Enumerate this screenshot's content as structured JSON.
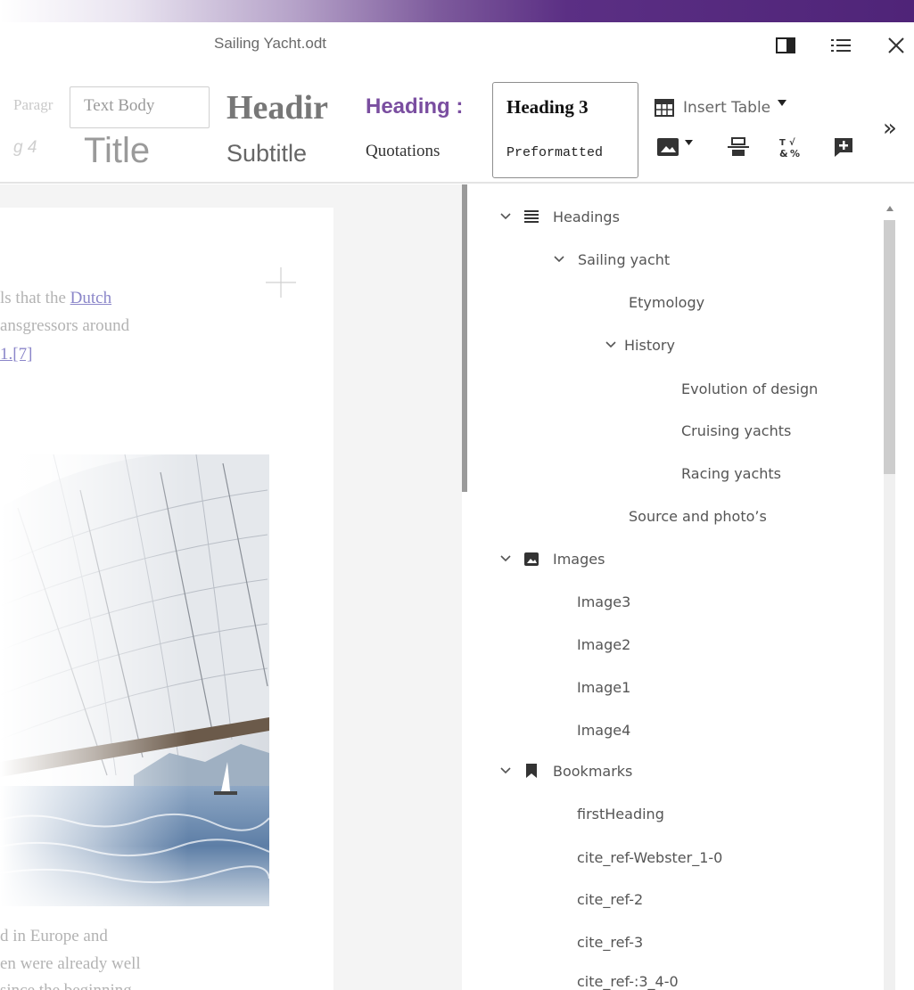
{
  "window": {
    "title": "Sailing Yacht.odt",
    "sidebar_icon": "sidebar-panel-icon",
    "menu_icon": "hamburger-list-icon",
    "close_icon": "close-icon"
  },
  "styles_gallery": {
    "row1": [
      {
        "label": "Paragr",
        "name": "style-paragraph"
      },
      {
        "label": "Text Body",
        "name": "style-text-body"
      },
      {
        "label": "Headir",
        "name": "style-heading-1"
      },
      {
        "label": "Heading :",
        "name": "style-heading-2"
      },
      {
        "label": "Heading 3",
        "name": "style-heading-3"
      }
    ],
    "row2": [
      {
        "label": "g 4",
        "name": "style-heading-4"
      },
      {
        "label": "Title",
        "name": "style-title"
      },
      {
        "label": "Subtitle",
        "name": "style-subtitle"
      },
      {
        "label": "Quotations",
        "name": "style-quotations"
      },
      {
        "label": "Preformatted",
        "name": "style-preformatted"
      }
    ]
  },
  "insert_toolbar": {
    "insert_table_label": "Insert Table",
    "more_label": "»",
    "icons": [
      "table-icon",
      "image-icon",
      "line-break-icon",
      "special-character-icon",
      "add-comment-icon"
    ]
  },
  "document": {
    "lines_top": [
      "ls that the ",
      "Dutch ",
      "ansgressors around",
      "1.[7]"
    ],
    "link_text": "Dutch",
    "lines_bottom": [
      "d in Europe and",
      "en were already well",
      "since the beginning"
    ]
  },
  "navigator": {
    "categories": [
      {
        "label": "Headings",
        "icon": "headings-icon",
        "expanded": true,
        "items": [
          {
            "label": "Sailing yacht",
            "level": 1,
            "expanded": true
          },
          {
            "label": "Etymology",
            "level": 2
          },
          {
            "label": "History",
            "level": 2,
            "expanded": true
          },
          {
            "label": "Evolution of design",
            "level": 3
          },
          {
            "label": "Cruising yachts",
            "level": 3
          },
          {
            "label": "Racing yachts",
            "level": 3
          },
          {
            "label": "Source and photo’s",
            "level": 2
          }
        ]
      },
      {
        "label": "Images",
        "icon": "image-icon",
        "expanded": true,
        "items": [
          {
            "label": "Image3"
          },
          {
            "label": "Image2"
          },
          {
            "label": "Image1"
          },
          {
            "label": "Image4"
          }
        ]
      },
      {
        "label": "Bookmarks",
        "icon": "bookmark-icon",
        "expanded": true,
        "items": [
          {
            "label": "firstHeading"
          },
          {
            "label": "cite_ref-Webster_1-0"
          },
          {
            "label": "cite_ref-2"
          },
          {
            "label": "cite_ref-3"
          },
          {
            "label": "cite_ref-:3_4-0"
          }
        ]
      }
    ]
  },
  "colors": {
    "accent_purple": "#5b2f84",
    "heading2_color": "#7a4ea0",
    "link_color": "#8b86c9"
  }
}
